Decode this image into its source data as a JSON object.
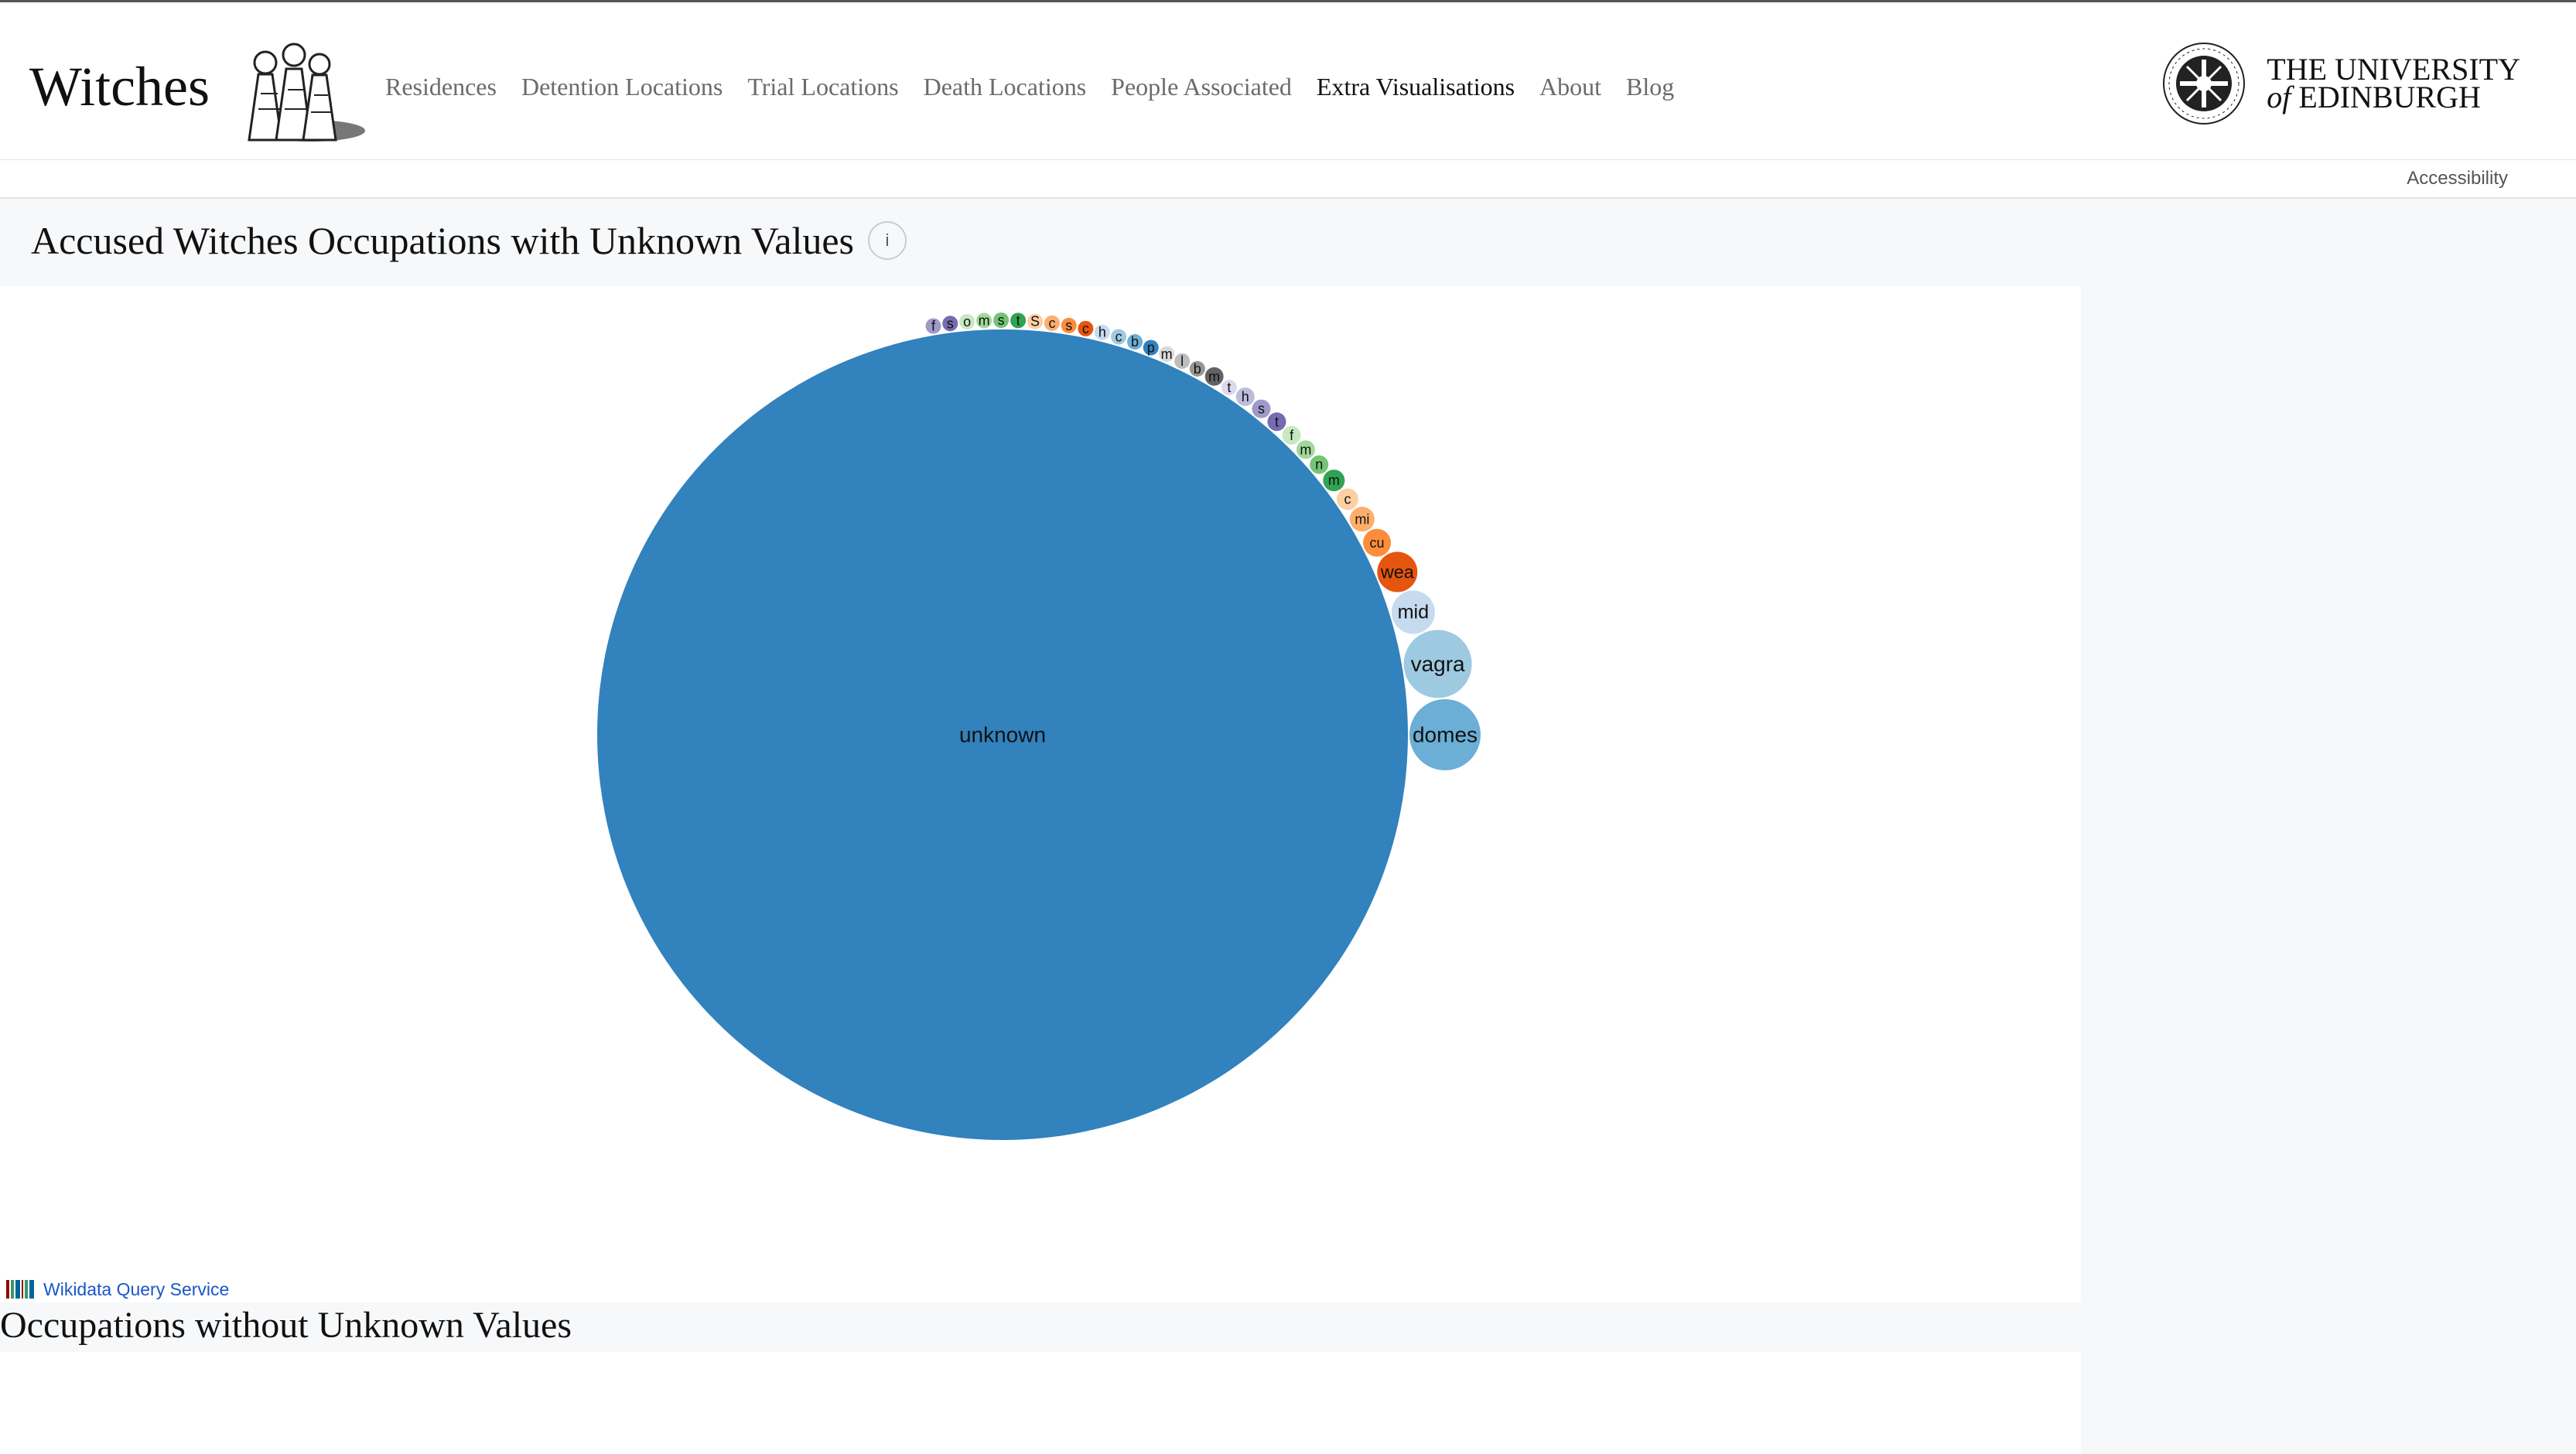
{
  "header": {
    "brand": "Witches",
    "nav": [
      {
        "label": "Residences",
        "active": false
      },
      {
        "label": "Detention Locations",
        "active": false
      },
      {
        "label": "Trial Locations",
        "active": false
      },
      {
        "label": "Death Locations",
        "active": false
      },
      {
        "label": "People Associated",
        "active": false
      },
      {
        "label": "Extra Visualisations",
        "active": true
      },
      {
        "label": "About",
        "active": false
      },
      {
        "label": "Blog",
        "active": false
      }
    ],
    "university": {
      "line1": "THE UNIVERSITY",
      "line2_prefix": "of",
      "line2": "EDINBURGH"
    }
  },
  "subbar": {
    "accessibility": "Accessibility"
  },
  "section1": {
    "title": "Accused Witches Occupations with Unknown Values",
    "info_icon": "i"
  },
  "chart_data": {
    "type": "bubble",
    "bubbles": [
      {
        "label": "unknown",
        "r": 262,
        "color": "#3182bd"
      },
      {
        "label": "domes",
        "r": 23,
        "color": "#6baed6"
      },
      {
        "label": "vagra",
        "r": 22,
        "color": "#9ecae1"
      },
      {
        "label": "mid",
        "r": 14,
        "color": "#c6dbef"
      },
      {
        "label": "wea",
        "r": 13,
        "color": "#e6550d"
      },
      {
        "label": "cu",
        "r": 9,
        "color": "#fd8d3c"
      },
      {
        "label": "mi",
        "r": 8,
        "color": "#fdae6b"
      },
      {
        "label": "c",
        "r": 7,
        "color": "#fdd0a2"
      },
      {
        "label": "m",
        "r": 7,
        "color": "#31a354"
      },
      {
        "label": "n",
        "r": 6,
        "color": "#74c476"
      },
      {
        "label": "m",
        "r": 6,
        "color": "#a1d99b"
      },
      {
        "label": "f",
        "r": 6,
        "color": "#c7e9c0"
      },
      {
        "label": "t",
        "r": 6,
        "color": "#756bb1"
      },
      {
        "label": "s",
        "r": 6,
        "color": "#9e9ac8"
      },
      {
        "label": "h",
        "r": 6,
        "color": "#bcbddc"
      },
      {
        "label": "t",
        "r": 5,
        "color": "#dadaeb"
      },
      {
        "label": "m",
        "r": 6,
        "color": "#636363"
      },
      {
        "label": "b",
        "r": 5,
        "color": "#969696"
      },
      {
        "label": "l",
        "r": 5,
        "color": "#bdbdbd"
      },
      {
        "label": "m",
        "r": 5,
        "color": "#d9d9d9"
      },
      {
        "label": "p",
        "r": 5,
        "color": "#3182bd"
      },
      {
        "label": "b",
        "r": 5,
        "color": "#6baed6"
      },
      {
        "label": "c",
        "r": 5,
        "color": "#9ecae1"
      },
      {
        "label": "h",
        "r": 5,
        "color": "#c6dbef"
      },
      {
        "label": "c",
        "r": 5,
        "color": "#e6550d"
      },
      {
        "label": "s",
        "r": 5,
        "color": "#fd8d3c"
      },
      {
        "label": "c",
        "r": 5,
        "color": "#fdae6b"
      },
      {
        "label": "S",
        "r": 5,
        "color": "#fdd0a2"
      },
      {
        "label": "t",
        "r": 5,
        "color": "#31a354"
      },
      {
        "label": "s",
        "r": 5,
        "color": "#74c476"
      },
      {
        "label": "m",
        "r": 5,
        "color": "#a1d99b"
      },
      {
        "label": "o",
        "r": 5,
        "color": "#c7e9c0"
      },
      {
        "label": "s",
        "r": 5,
        "color": "#756bb1"
      },
      {
        "label": "f",
        "r": 5,
        "color": "#9e9ac8"
      }
    ]
  },
  "footer_link": {
    "label": "Wikidata Query Service"
  },
  "section2": {
    "title": "Occupations without Unknown Values"
  }
}
